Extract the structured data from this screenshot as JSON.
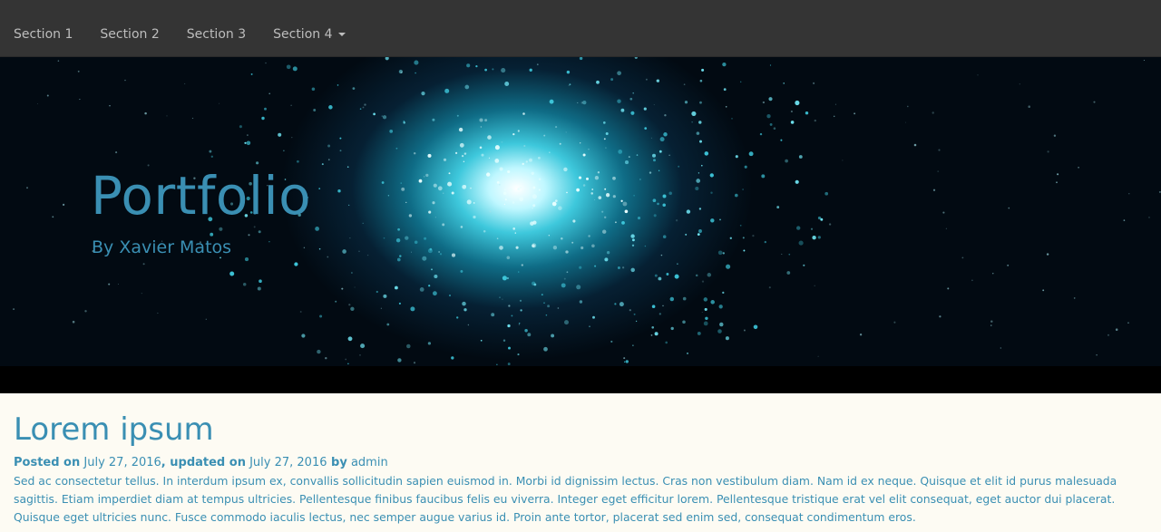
{
  "nav": {
    "items": [
      {
        "label": "Section 1"
      },
      {
        "label": "Section 2"
      },
      {
        "label": "Section 3"
      },
      {
        "label": "Section 4"
      }
    ]
  },
  "hero": {
    "title": "Portfolio",
    "subtitle": "By Xavier Matos"
  },
  "post": {
    "title": "Lorem ipsum",
    "meta": {
      "posted_on_label": "Posted on",
      "posted_date": "July 27, 2016",
      "updated_on_label": ", updated on",
      "updated_date": "July 27, 2016",
      "by_label": " by",
      "author": "admin"
    },
    "body": "Sed ac consectetur tellus. In interdum ipsum ex, convallis sollicitudin sapien euismod in. Morbi id dignissim lectus. Cras non vestibulum diam. Nam id ex neque. Quisque et elit id purus malesuada sagittis. Etiam imperdiet diam at tempus ultricies. Pellentesque finibus faucibus felis eu viverra. Integer eget efficitur lorem. Pellentesque tristique erat vel elit consequat, eget auctor dui placerat. Quisque eget ultricies nunc. Fusce commodo iaculis lectus, nec semper augue varius id. Proin ante tortor, placerat sed enim sed, consequat condimentum eros."
  },
  "colors": {
    "navbar_bg": "#343434",
    "nav_text": "#bdbdbd",
    "accent": "#3a8fb3",
    "page_bg": "#fdfbf3"
  }
}
